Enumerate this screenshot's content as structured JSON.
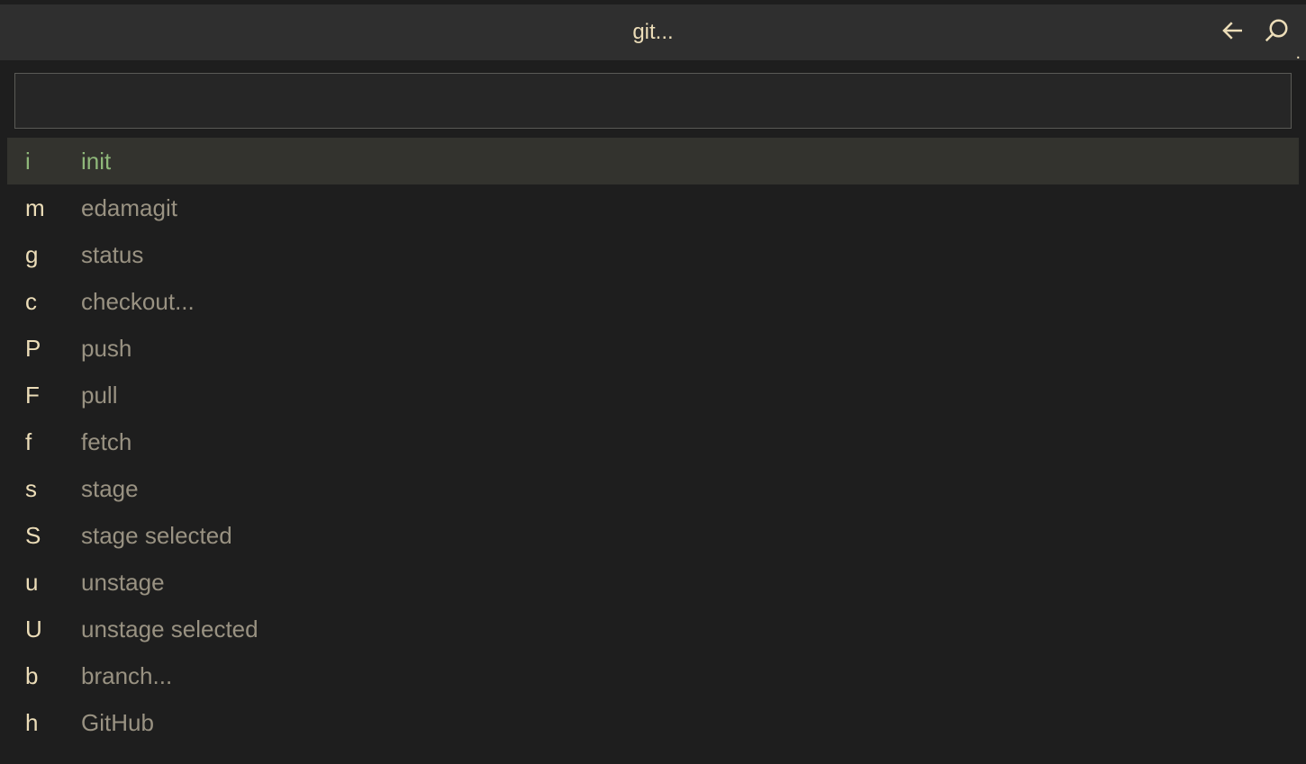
{
  "header": {
    "title": "git..."
  },
  "search": {
    "value": "",
    "placeholder": ""
  },
  "trailing_text": ".",
  "items": [
    {
      "key": "i",
      "label": "init",
      "selected": true
    },
    {
      "key": "m",
      "label": "edamagit",
      "selected": false
    },
    {
      "key": "g",
      "label": "status",
      "selected": false
    },
    {
      "key": "c",
      "label": "checkout...",
      "selected": false
    },
    {
      "key": "P",
      "label": "push",
      "selected": false
    },
    {
      "key": "F",
      "label": "pull",
      "selected": false
    },
    {
      "key": "f",
      "label": "fetch",
      "selected": false
    },
    {
      "key": "s",
      "label": "stage",
      "selected": false
    },
    {
      "key": "S",
      "label": "stage selected",
      "selected": false
    },
    {
      "key": "u",
      "label": "unstage",
      "selected": false
    },
    {
      "key": "U",
      "label": "unstage selected",
      "selected": false
    },
    {
      "key": "b",
      "label": "branch...",
      "selected": false
    },
    {
      "key": "h",
      "label": "GitHub",
      "selected": false
    }
  ]
}
